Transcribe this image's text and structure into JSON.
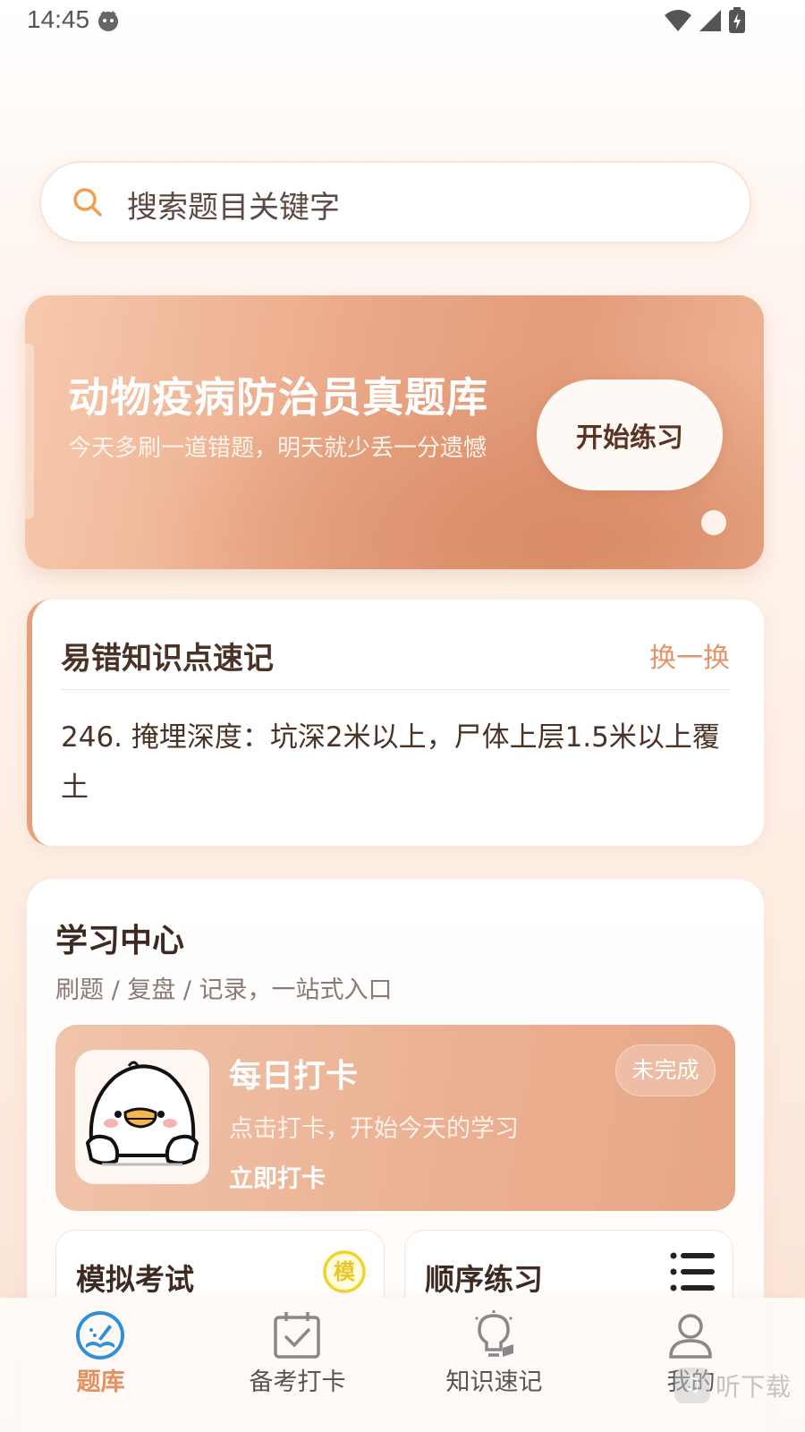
{
  "status_bar": {
    "time": "14:45"
  },
  "search": {
    "placeholder": "搜索题目关键字"
  },
  "banner": {
    "title": "动物疫病防治员真题库",
    "subtitle": "今天多刷一道错题，明天就少丢一分遗憾",
    "button_label": "开始练习"
  },
  "knowledge": {
    "title": "易错知识点速记",
    "refresh_label": "换一换",
    "content": "246. 掩埋深度：坑深2米以上，尸体上层1.5米以上覆土"
  },
  "study_center": {
    "title": "学习中心",
    "subtitle": "刷题 / 复盘 / 记录，一站式入口",
    "checkin": {
      "title": "每日打卡",
      "description": "点击打卡，开始今天的学习",
      "action_label": "立即打卡",
      "status_badge": "未完成"
    },
    "mock_exam": {
      "title": "模拟考试",
      "icon_glyph": "模"
    },
    "sequential": {
      "title": "顺序练习"
    }
  },
  "tabbar": {
    "tabs": [
      {
        "label": "题库",
        "icon": "book-icon",
        "active": true
      },
      {
        "label": "备考打卡",
        "icon": "calendar-check-icon",
        "active": false
      },
      {
        "label": "知识速记",
        "icon": "lightbulb-icon",
        "active": false
      },
      {
        "label": "我的",
        "icon": "person-icon",
        "active": false
      }
    ]
  },
  "watermark": {
    "text": "听下载"
  },
  "colors": {
    "accent": "#e4905f",
    "banner_start": "#f7c9ae",
    "banner_end": "#e49c7a",
    "text_dark": "#3e2a20"
  }
}
